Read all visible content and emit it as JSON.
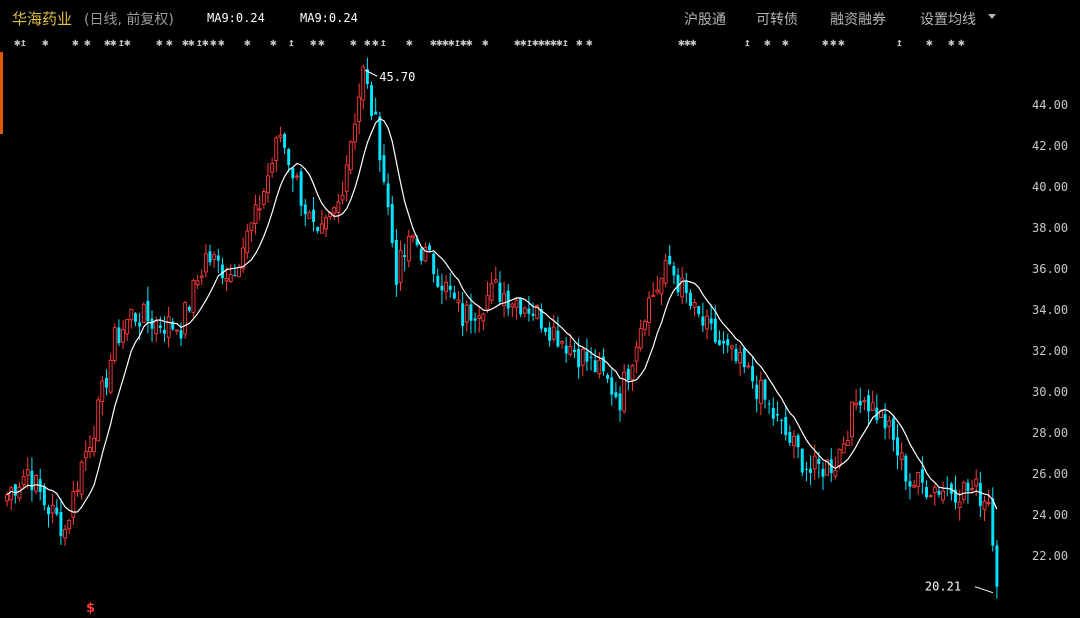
{
  "header": {
    "stock_name": "华海药业",
    "period_label": "(日线, 前复权)",
    "ma_label_1": "MA9:0.24",
    "ma_label_2": "MA9:0.24",
    "menu": [
      "沪股通",
      "可转债",
      "融资融券",
      "设置均线"
    ]
  },
  "colors": {
    "up": "#ff3a3a",
    "down": "#00e5ff",
    "ma": "#ffffff",
    "background": "#000000",
    "accent": "#e05a00"
  },
  "markers": {
    "event_symbol": "✱",
    "event_symbol_alt": "↥",
    "dividend_symbol": "$"
  },
  "chart_data": {
    "type": "candlestick",
    "ylim": [
      20.0,
      46.2
    ],
    "yticks": [
      "22.00",
      "24.00",
      "26.00",
      "28.00",
      "30.00",
      "32.00",
      "34.00",
      "36.00",
      "38.00",
      "40.00",
      "42.00",
      "44.00"
    ],
    "max_label": "45.70",
    "min_label": "20.21",
    "ma_period": 9,
    "candle_count": 240,
    "keypoints": [
      [
        0,
        25.0
      ],
      [
        5,
        26.2
      ],
      [
        9,
        24.6
      ],
      [
        14,
        23.3
      ],
      [
        18,
        26.5
      ],
      [
        22,
        29.0
      ],
      [
        26,
        32.5
      ],
      [
        30,
        33.8
      ],
      [
        36,
        33.4
      ],
      [
        42,
        33.2
      ],
      [
        48,
        36.6
      ],
      [
        54,
        35.8
      ],
      [
        60,
        38.5
      ],
      [
        66,
        42.6
      ],
      [
        70,
        40.2
      ],
      [
        75,
        37.2
      ],
      [
        80,
        39.2
      ],
      [
        86,
        45.6
      ],
      [
        90,
        42.0
      ],
      [
        94,
        35.8
      ],
      [
        98,
        37.5
      ],
      [
        104,
        35.8
      ],
      [
        110,
        33.6
      ],
      [
        118,
        35.0
      ],
      [
        126,
        34.2
      ],
      [
        134,
        32.6
      ],
      [
        142,
        31.2
      ],
      [
        148,
        29.7
      ],
      [
        154,
        34.1
      ],
      [
        160,
        36.2
      ],
      [
        166,
        33.8
      ],
      [
        172,
        32.3
      ],
      [
        180,
        30.6
      ],
      [
        186,
        28.5
      ],
      [
        194,
        26.1
      ],
      [
        200,
        26.6
      ],
      [
        206,
        30.0
      ],
      [
        212,
        28.5
      ],
      [
        218,
        25.6
      ],
      [
        226,
        25.3
      ],
      [
        234,
        25.2
      ],
      [
        237,
        24.6
      ],
      [
        238,
        23.2
      ],
      [
        239,
        20.5
      ]
    ]
  }
}
